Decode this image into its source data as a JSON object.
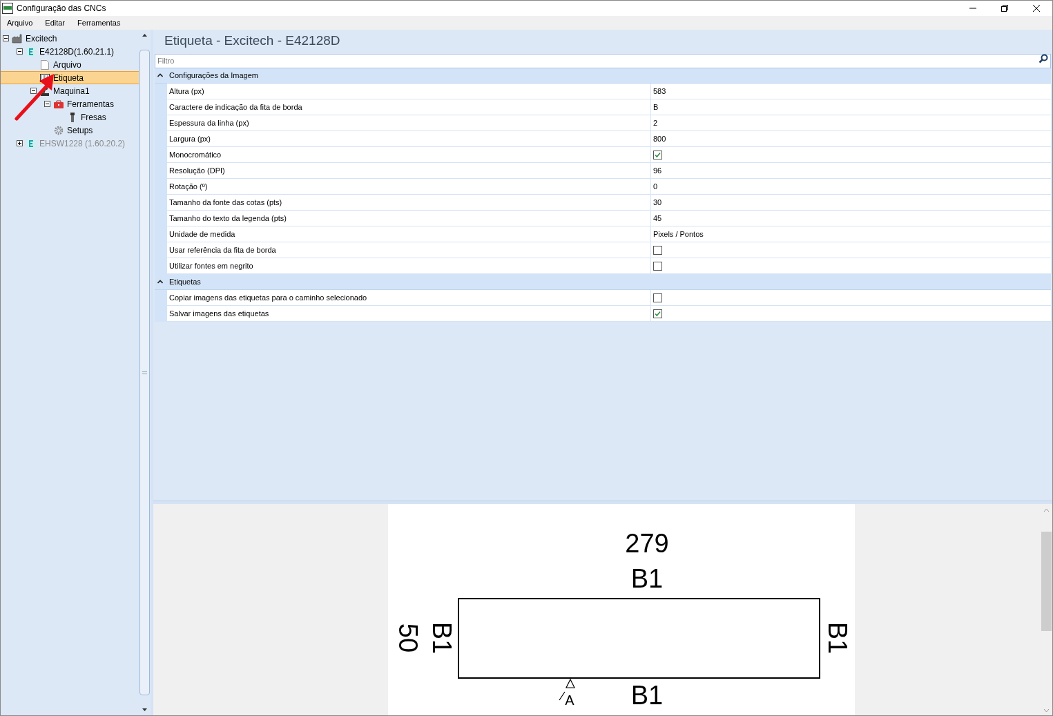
{
  "window": {
    "title": "Configuração das CNCs"
  },
  "menu": [
    "Arquivo",
    "Editar",
    "Ferramentas"
  ],
  "tree": [
    {
      "label": "Excitech",
      "kind": "factory",
      "expanded": true,
      "selected": false,
      "disabled": false,
      "children": [
        {
          "label": "E42128D(1.60.21.1)",
          "kind": "machine",
          "expanded": true,
          "selected": false,
          "disabled": false,
          "children": [
            {
              "label": "Arquivo",
              "kind": "file",
              "selected": false,
              "disabled": false
            },
            {
              "label": "Etiqueta",
              "kind": "label",
              "selected": true,
              "disabled": false
            },
            {
              "label": "Maquina1",
              "kind": "arm",
              "expanded": true,
              "selected": false,
              "disabled": false,
              "children": [
                {
                  "label": "Ferramentas",
                  "kind": "toolbox",
                  "expanded": true,
                  "selected": false,
                  "disabled": false,
                  "children": [
                    {
                      "label": "Fresas",
                      "kind": "tool",
                      "selected": false,
                      "disabled": false
                    }
                  ]
                },
                {
                  "label": "Setups",
                  "kind": "gear",
                  "selected": false,
                  "disabled": false
                }
              ]
            }
          ]
        },
        {
          "label": "EHSW1228 (1.60.20.2)",
          "kind": "machine",
          "expanded": false,
          "selected": false,
          "disabled": true
        }
      ]
    }
  ],
  "panel": {
    "title": "Etiqueta - Excitech - E42128D",
    "filter": {
      "placeholder": "Filtro"
    }
  },
  "sections": [
    {
      "title": "Configurações da Imagem",
      "expanded": true,
      "rows": [
        {
          "name": "Altura (px)",
          "kind": "text",
          "value": "583"
        },
        {
          "name": "Caractere de indicação da fita de borda",
          "kind": "text",
          "value": "B"
        },
        {
          "name": "Espessura da linha (px)",
          "kind": "text",
          "value": "2"
        },
        {
          "name": "Largura (px)",
          "kind": "text",
          "value": "800"
        },
        {
          "name": "Monocromático",
          "kind": "checkbox",
          "checked": true
        },
        {
          "name": "Resolução (DPI)",
          "kind": "text",
          "value": "96"
        },
        {
          "name": "Rotação (º)",
          "kind": "text",
          "value": "0"
        },
        {
          "name": "Tamanho da fonte das cotas (pts)",
          "kind": "text",
          "value": "30"
        },
        {
          "name": "Tamanho do texto da legenda (pts)",
          "kind": "text",
          "value": "45"
        },
        {
          "name": "Unidade de medida",
          "kind": "text",
          "value": "Pixels / Pontos"
        },
        {
          "name": "Usar referência da fita de borda",
          "kind": "checkbox",
          "checked": false
        },
        {
          "name": "Utilizar fontes em negrito",
          "kind": "checkbox",
          "checked": false
        }
      ]
    },
    {
      "title": "Etiquetas",
      "expanded": true,
      "rows": [
        {
          "name": "Copiar imagens das etiquetas para o caminho selecionado",
          "kind": "checkbox",
          "checked": false
        },
        {
          "name": "Salvar imagens das etiquetas",
          "kind": "checkbox",
          "checked": true
        }
      ]
    }
  ],
  "preview": {
    "width_label": "279",
    "height_label": "50",
    "top_edge": "B1",
    "left_edge": "B1",
    "right_edge": "B1",
    "bottom_edge": "B1",
    "grain_mark": "A"
  }
}
